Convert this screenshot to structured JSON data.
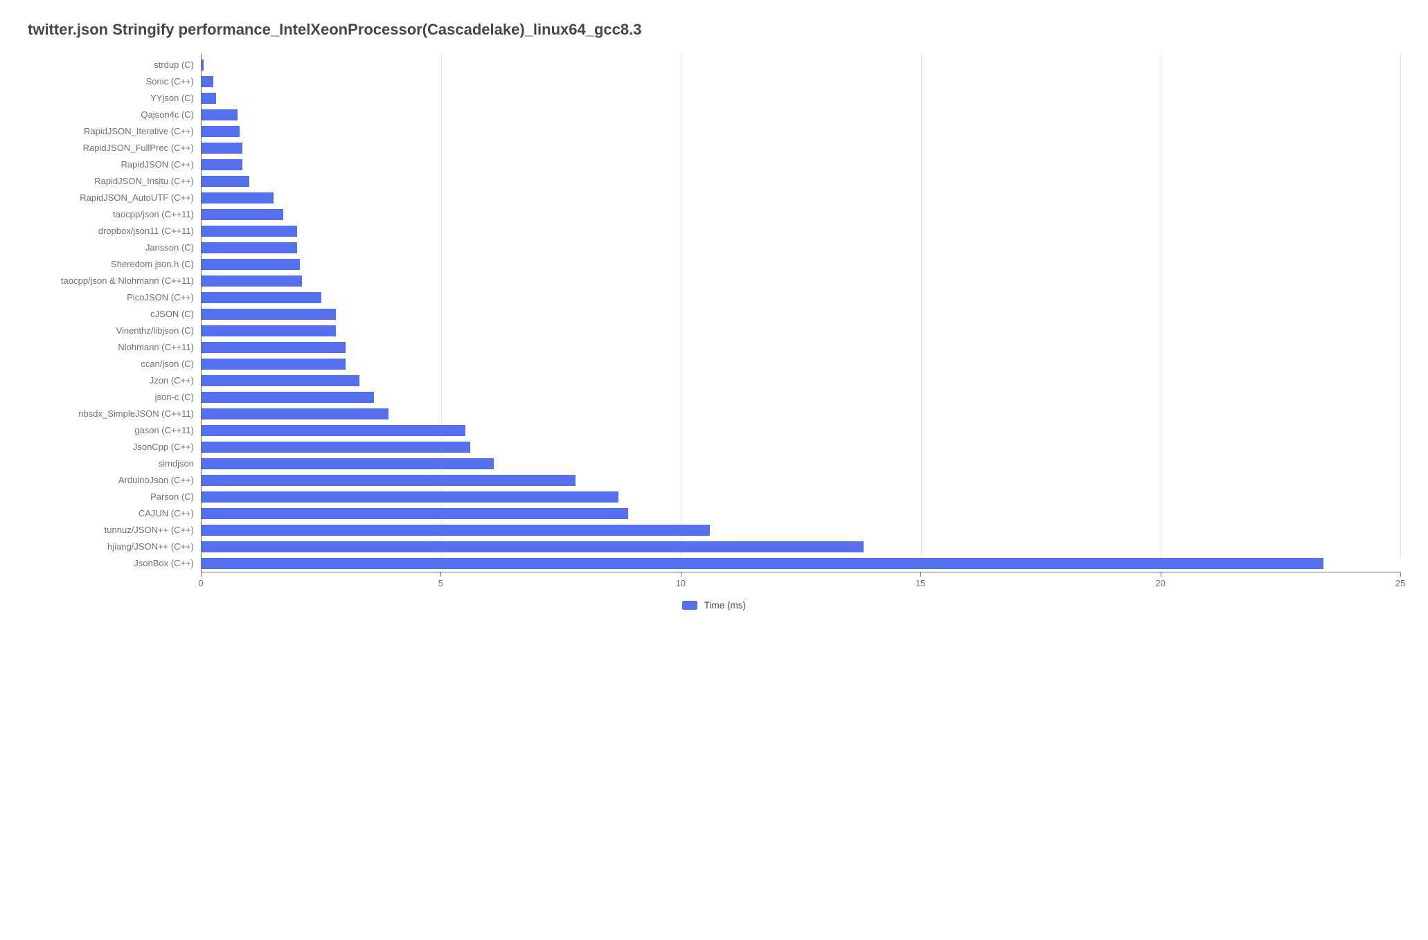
{
  "chart_data": {
    "type": "bar",
    "title": "twitter.json Stringify performance_IntelXeonProcessor(Cascadelake)_linux64_gcc8.3",
    "xlabel": "",
    "ylabel": "",
    "xlim": [
      0,
      25
    ],
    "xticks": [
      0,
      5,
      10,
      15,
      20,
      25
    ],
    "legend": "Time (ms)",
    "categories": [
      "strdup (C)",
      "Sonic (C++)",
      "YYjson (C)",
      "Qajson4c (C)",
      "RapidJSON_Iterative (C++)",
      "RapidJSON_FullPrec (C++)",
      "RapidJSON (C++)",
      "RapidJSON_Insitu (C++)",
      "RapidJSON_AutoUTF (C++)",
      "taocpp/json (C++11)",
      "dropbox/json11 (C++11)",
      "Jansson (C)",
      "Sheredom json.h (C)",
      "taocpp/json & Nlohmann (C++11)",
      "PicoJSON (C++)",
      "cJSON (C)",
      "Vinenthz/libjson (C)",
      "Nlohmann (C++11)",
      "ccan/json (C)",
      "Jzon (C++)",
      "json-c (C)",
      "nbsdx_SimpleJSON (C++11)",
      "gason (C++11)",
      "JsonCpp (C++)",
      "simdjson",
      "ArduinoJson (C++)",
      "Parson (C)",
      "CAJUN (C++)",
      "tunnuz/JSON++ (C++)",
      "hjiang/JSON++ (C++)",
      "JsonBox (C++)"
    ],
    "values": [
      0.05,
      0.25,
      0.3,
      0.75,
      0.8,
      0.85,
      0.85,
      1.0,
      1.5,
      1.7,
      2.0,
      2.0,
      2.05,
      2.1,
      2.5,
      2.8,
      2.8,
      3.0,
      3.0,
      3.3,
      3.6,
      3.9,
      5.5,
      5.6,
      6.1,
      7.8,
      8.7,
      8.9,
      10.6,
      13.8,
      23.4
    ]
  },
  "colors": {
    "bar": "#5470ee"
  }
}
